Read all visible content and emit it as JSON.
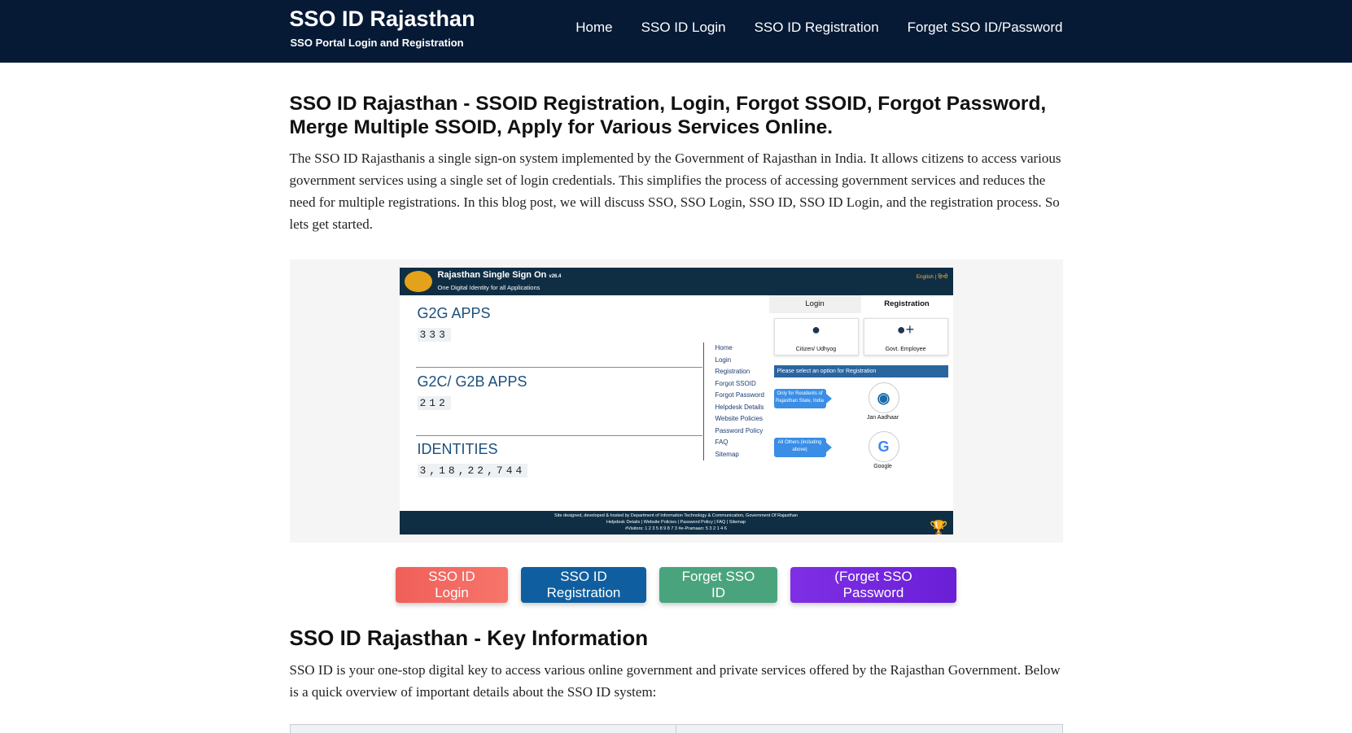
{
  "header": {
    "title": "SSO ID Rajasthan",
    "subtitle": "SSO Portal Login and Registration",
    "nav": [
      "Home",
      "SSO ID Login",
      "SSO ID Registration",
      "Forget SSO ID/Password"
    ]
  },
  "article": {
    "heading": "SSO ID Rajasthan - SSOID Registration, Login, Forgot SSOID, Forgot Password, Merge Multiple SSOID, Apply for Various Services Online.",
    "intro": "The SSO ID Rajasthanis a single sign-on system implemented by the Government of Rajasthan in India. It allows citizens to access various government services using a single set of login credentials. This simplifies the process of accessing government services and reduces the need for multiple registrations. In this blog post, we will discuss SSO, SSO Login, SSO ID, SSO ID Login, and the registration process. So lets get started."
  },
  "screenshot": {
    "title": "Rajasthan Single Sign On",
    "version": "v26.4",
    "tagline": "One Digital Identity for all Applications",
    "lang": "English | हिन्दी",
    "stats": [
      {
        "label": "G2G APPS",
        "value": "333"
      },
      {
        "label": "G2C/ G2B APPS",
        "value": "212"
      },
      {
        "label": "IDENTITIES",
        "value": "3,18,22,744"
      }
    ],
    "menu": [
      "Home",
      "Login",
      "Registration",
      "Forgot SSOID",
      "Forgot Password",
      "Helpdesk Details",
      "Website Policies",
      "Password Policy",
      "FAQ",
      "Sitemap"
    ],
    "tabs": {
      "login": "Login",
      "registration": "Registration"
    },
    "options": [
      "Citizen/ Udhyog",
      "Govt. Employee"
    ],
    "reg_prompt": "Please select an option for Registration",
    "residents_note": "Only for Residents of Rajasthan State, India",
    "others_note": "All Others (including above)",
    "jan_aadhaar": "Jan Aadhaar",
    "google": "Google",
    "footer_line1": "Site designed, developed & hosted by Department of Information Technology & Communication, Government Of Rajasthan",
    "footer_line2": "Helpdesk Details | Website Policies | Password Policy | FAQ | Sitemap",
    "footer_line3": "#Visitors: 1 2 3 5 8 9 8 7 3   #e-Pramaan: 5 3 2 1 4 6"
  },
  "buttons": {
    "login": "SSO ID Login",
    "registration": "SSO ID Registration",
    "forget_id": "Forget SSO ID",
    "forget_password": "(Forget SSO Password"
  },
  "key_info": {
    "heading": "SSO ID Rajasthan - Key Information",
    "intro": "SSO ID is your one-stop digital key to access various online government and private services offered by the Rajasthan Government. Below is a quick overview of important details about the SSO ID system:"
  }
}
